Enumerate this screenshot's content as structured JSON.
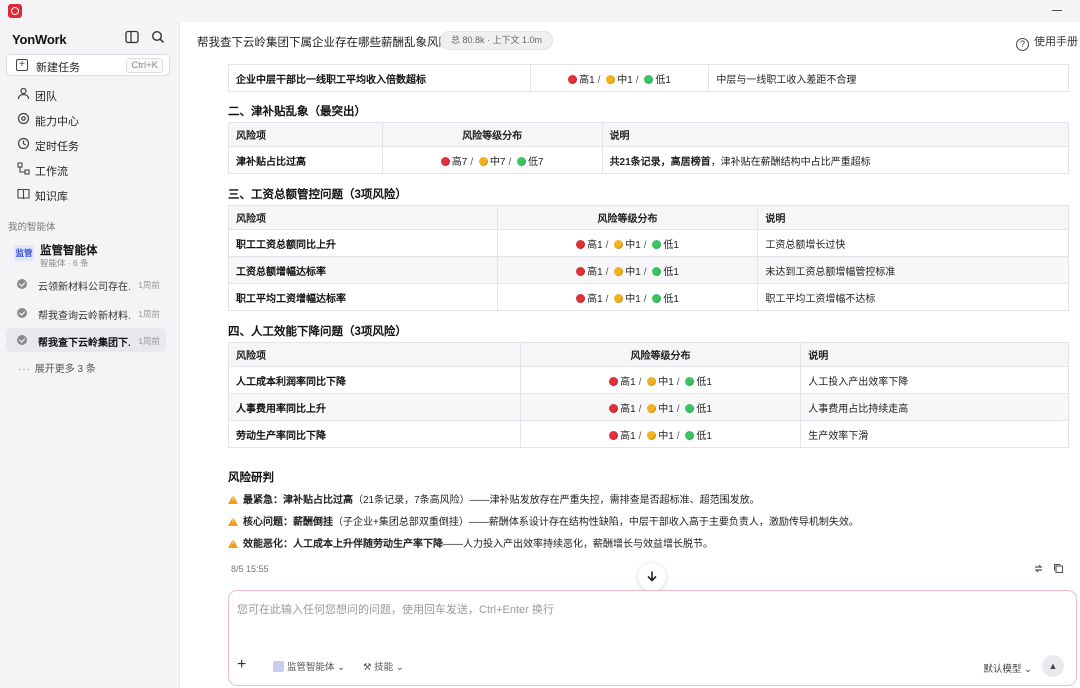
{
  "app": {
    "brand": "YonWork"
  },
  "sidebar": {
    "new_task": {
      "label": "新建任务",
      "shortcut": "Ctrl+K"
    },
    "nav": [
      {
        "label": "团队",
        "icon": "team-icon"
      },
      {
        "label": "能力中心",
        "icon": "capability-icon"
      },
      {
        "label": "定时任务",
        "icon": "clock-icon"
      },
      {
        "label": "工作流",
        "icon": "workflow-icon"
      },
      {
        "label": "知识库",
        "icon": "book-icon"
      }
    ],
    "section_label": "我的智能体",
    "agent": {
      "badge": "监管",
      "name": "监管智能体",
      "sub": "智能体 · 6 条"
    },
    "history": [
      {
        "label": "云领新材料公司存在...",
        "time": "1周前"
      },
      {
        "label": "帮我查询云岭新材料...",
        "time": "1周前"
      },
      {
        "label": "帮我查下云岭集团下...",
        "time": "1周前"
      }
    ],
    "more": "展开更多 3 条"
  },
  "header": {
    "title": "帮我查下云岭集团下属企业存在哪些薪酬乱象风险",
    "context_badge": "总 80.8k · 上下文 1.0m",
    "help": "使用手册"
  },
  "risk_labels": {
    "high": "高",
    "mid": "中",
    "low": "低"
  },
  "sections": {
    "partial_row": {
      "item": "企业中层干部比一线职工平均收入倍数超标",
      "high": "1",
      "mid": "1",
      "low": "1",
      "note": "中层与一线职工收入差距不合理"
    },
    "s2": {
      "title": "二、津补贴乱象（最突出）",
      "headers": [
        "风险项",
        "风险等级分布",
        "说明"
      ],
      "rows": [
        {
          "item": "津补贴占比过高",
          "high": "7",
          "mid": "7",
          "low": "7",
          "note_bold": "共21条记录，高居榜首",
          "note": "，津补贴在薪酬结构中占比严重超标"
        }
      ]
    },
    "s3": {
      "title": "三、工资总额管控问题（3项风险）",
      "headers": [
        "风险项",
        "风险等级分布",
        "说明"
      ],
      "rows": [
        {
          "item": "职工工资总额同比上升",
          "high": "1",
          "mid": "1",
          "low": "1",
          "note": "工资总额增长过快"
        },
        {
          "item": "工资总额增幅达标率",
          "high": "1",
          "mid": "1",
          "low": "1",
          "note": "未达到工资总额增幅管控标准"
        },
        {
          "item": "职工平均工资增幅达标率",
          "high": "1",
          "mid": "1",
          "low": "1",
          "note": "职工平均工资增幅不达标"
        }
      ]
    },
    "s4": {
      "title": "四、人工效能下降问题（3项风险）",
      "headers": [
        "风险项",
        "风险等级分布",
        "说明"
      ],
      "rows": [
        {
          "item": "人工成本利润率同比下降",
          "high": "1",
          "mid": "1",
          "low": "1",
          "note": "人工投入产出效率下降"
        },
        {
          "item": "人事费用率同比上升",
          "high": "1",
          "mid": "1",
          "low": "1",
          "note": "人事费用占比持续走高"
        },
        {
          "item": "劳动生产率同比下降",
          "high": "1",
          "mid": "1",
          "low": "1",
          "note": "生产效率下滑"
        }
      ]
    }
  },
  "judgement": {
    "title": "风险研判",
    "items": [
      {
        "bold": "最紧急：津补贴占比过高",
        "text": "（21条记录，7条高风险）——津补贴发放存在严重失控，需排查是否超标准、超范围发放。"
      },
      {
        "bold": "核心问题：薪酬倒挂",
        "text": "（子企业+集团总部双重倒挂）——薪酬体系设计存在结构性缺陷，中层干部收入高于主要负责人，激励传导机制失效。"
      },
      {
        "bold": "效能恶化：人工成本上升伴随劳动生产率下降",
        "text": "——人力投入产出效率持续恶化，薪酬增长与效益增长脱节。"
      }
    ]
  },
  "timestamp": "8/5 15:55",
  "composer": {
    "placeholder": "您可在此输入任何您想问的问题，使用回车发送，Ctrl+Enter 换行",
    "agent_chip": "监管智能体",
    "skill_chip": "技能",
    "model": "默认模型"
  }
}
